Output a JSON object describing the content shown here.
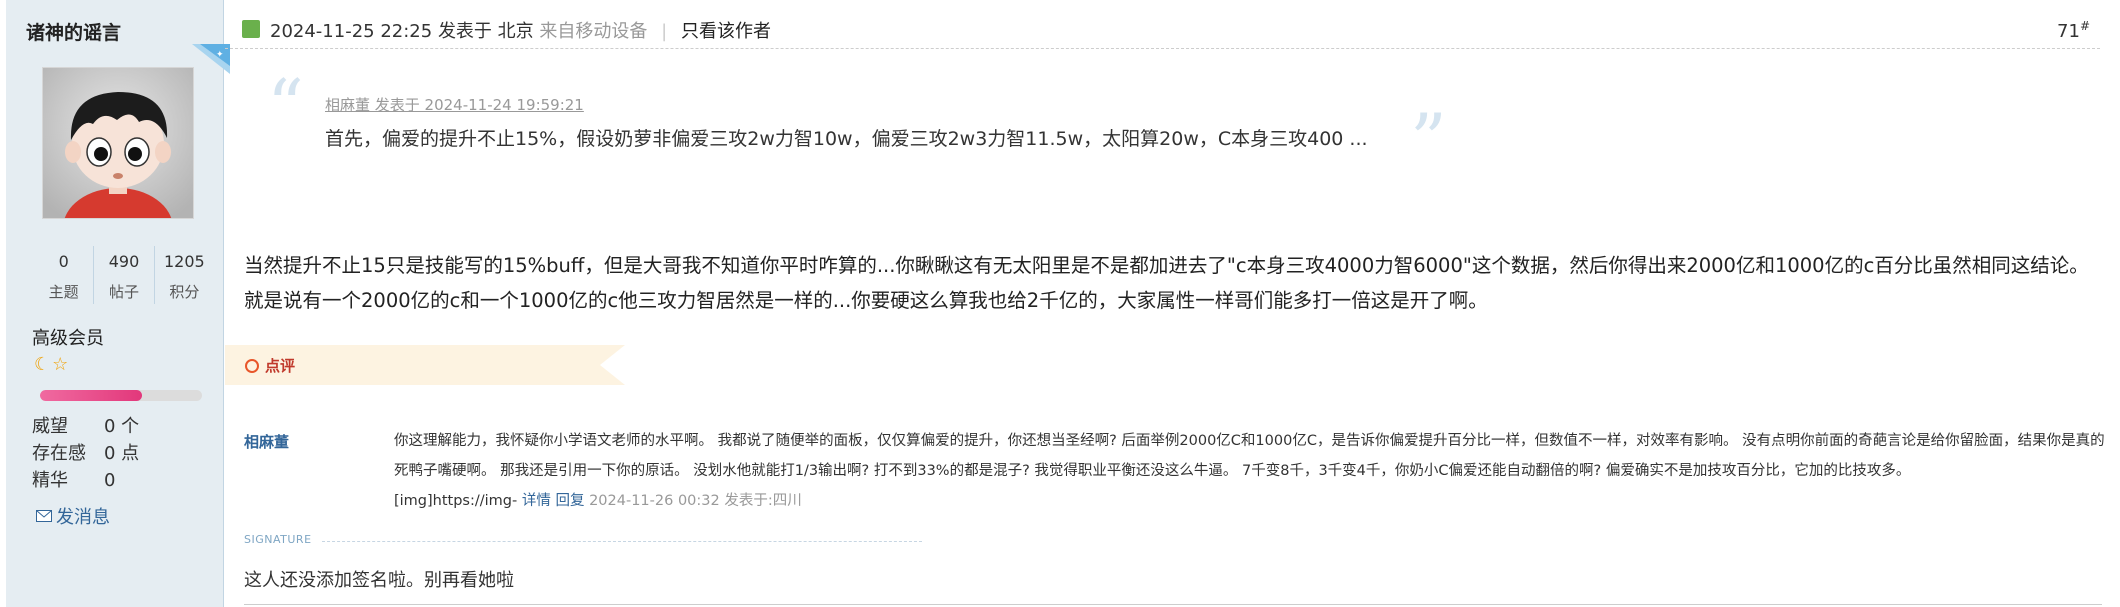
{
  "user": {
    "name": "诸神的谣言",
    "stats": [
      {
        "value": "0",
        "label": "主题"
      },
      {
        "value": "490",
        "label": "帖子"
      },
      {
        "value": "1205",
        "label": "积分"
      }
    ],
    "group": "高级会员",
    "level_progress": 0.63,
    "attributes": [
      {
        "key": "威望",
        "value": "0 个"
      },
      {
        "key": "存在感",
        "value": "0 点"
      },
      {
        "key": "精华",
        "value": "0"
      }
    ],
    "send_message": "发消息"
  },
  "post": {
    "datetime": "2024-11-25 22:25",
    "posted_in": "发表于 北京",
    "from_device": "来自移动设备",
    "separator": "|",
    "only_author": "只看该作者",
    "floor": "71",
    "floor_suffix": "#",
    "quote": {
      "author_line": "相麻董 发表于 2024-11-24 19:59:21",
      "text": "首先，偏爱的提升不止15%，假设奶萝非偏爱三攻2w力智10w，偏爱三攻2w3力智11.5w，太阳算20w，C本身三攻400 ..."
    },
    "body": "当然提升不止15只是技能写的15%buff，但是大哥我不知道你平时咋算的...你瞅瞅这有无太阳里是不是都加进去了\"c本身三攻4000力智6000\"这个数据，然后你得出来2000亿和1000亿的c百分比虽然相同这结论。就是说有一个2000亿的c和一个1000亿的c他三攻力智居然是一样的...你要硬这么算我也给2千亿的，大家属性一样哥们能多打一倍这是开了啊。"
  },
  "review": {
    "label": "点评",
    "comment": {
      "author": "相麻董",
      "text": "你这理解能力，我怀疑你小学语文老师的水平啊。 我都说了随便举的面板，仅仅算偏爱的提升，你还想当圣经啊? 后面举例2000亿C和1000亿C，是告诉你偏爱提升百分比一样，但数值不一样，对效率有影响。 没有点明你前面的奇葩言论是给你留脸面，结果你是真的死鸭子嘴硬啊。 那我还是引用一下你的原话。 没划水他就能打1/3输出啊? 打不到33%的都是混子? 我觉得职业平衡还没这么牛逼。 7千变8千，3千变4千，你奶小C偏爱还能自动翻倍的啊? 偏爱确实不是加技攻百分比，它加的比技攻多。 ",
      "img_text": "[img]https://img-",
      "detail_link": "详情",
      "reply_link": "回复",
      "time": "2024-11-26 00:32 发表于:四川"
    }
  },
  "signature": {
    "label": "SIGNATURE",
    "text": "这人还没添加签名啦。别再看她啦"
  }
}
